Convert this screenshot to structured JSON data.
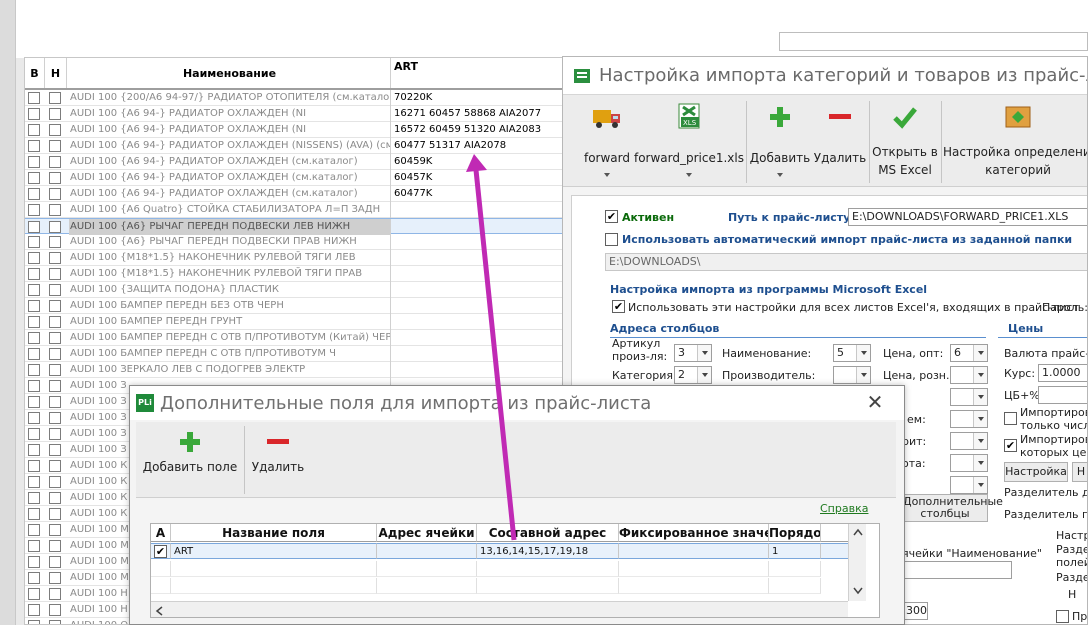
{
  "grid": {
    "headers": {
      "b": "В",
      "n": "Н",
      "name": "Наименование",
      "art": "ART"
    },
    "rows": [
      {
        "name": "AUDI 100 {200/A6 94-97/} РАДИАТОР ОТОПИТЕЛЯ (см.каталог)",
        "art": "70220K"
      },
      {
        "name": "AUDI 100 {A6 94-} РАДИАТОР ОХЛАЖДЕН (NI",
        "art": "16271 60457 58868 AIA2077"
      },
      {
        "name": "AUDI 100 {A6 94-} РАДИАТОР ОХЛАЖДЕН (NI",
        "art": "16572 60459 51320 AIA2083"
      },
      {
        "name": "AUDI 100 {A6 94-} РАДИАТОР ОХЛАЖДЕН (NISSENS) (AVA) (см.к",
        "art": "60477 51317 AIA2078"
      },
      {
        "name": "AUDI 100 {A6 94-} РАДИАТОР ОХЛАЖДЕН (см.каталог)",
        "art": "60459K"
      },
      {
        "name": "AUDI 100 {A6 94-} РАДИАТОР ОХЛАЖДЕН (см.каталог)",
        "art": "60457K"
      },
      {
        "name": "AUDI 100 {A6 94-} РАДИАТОР ОХЛАЖДЕН (см.каталог)",
        "art": "60477K"
      },
      {
        "name": "AUDI 100 {A6 Quatro} СТОЙКА СТАБИЛИЗАТОРА Л=П ЗАДН",
        "art": ""
      },
      {
        "name": "AUDI 100 {A6} РЫЧАГ ПЕРЕДН ПОДВЕСКИ ЛЕВ НИЖН",
        "art": ""
      },
      {
        "name": "AUDI 100 {A6} РЫЧАГ ПЕРЕДН ПОДВЕСКИ ПРАВ НИЖН",
        "art": ""
      },
      {
        "name": "AUDI 100 {M18*1.5} НАКОНЕЧНИК РУЛЕВОЙ ТЯГИ ЛЕВ",
        "art": ""
      },
      {
        "name": "AUDI 100 {M18*1.5} НАКОНЕЧНИК РУЛЕВОЙ ТЯГИ ПРАВ",
        "art": ""
      },
      {
        "name": "AUDI 100 {ЗАЩИТА ПОДОНА} ПЛАСТИК",
        "art": ""
      },
      {
        "name": "AUDI 100 БАМПЕР ПЕРЕДН БЕЗ ОТВ ЧЕРН",
        "art": ""
      },
      {
        "name": "AUDI 100 БАМПЕР ПЕРЕДН ГРУНТ",
        "art": ""
      },
      {
        "name": "AUDI 100 БАМПЕР ПЕРЕДН С ОТВ П/ПРОТИВОТУМ (Китай) ЧЕРН",
        "art": ""
      },
      {
        "name": "AUDI 100 БАМПЕР ПЕРЕДН С ОТВ П/ПРОТИВОТУМ Ч",
        "art": ""
      },
      {
        "name": "AUDI 100 ЗЕРКАЛО ЛЕВ С ПОДОГРЕВ ЭЛЕКТР",
        "art": ""
      },
      {
        "name": "AUDI 100 З",
        "art": ""
      },
      {
        "name": "AUDI 100 З",
        "art": ""
      },
      {
        "name": "AUDI 100 З",
        "art": ""
      },
      {
        "name": "AUDI 100 З",
        "art": ""
      },
      {
        "name": "AUDI 100 З",
        "art": ""
      },
      {
        "name": "AUDI 100 К",
        "art": ""
      },
      {
        "name": "AUDI 100 К",
        "art": ""
      },
      {
        "name": "AUDI 100 К",
        "art": ""
      },
      {
        "name": "AUDI 100 К",
        "art": ""
      },
      {
        "name": "AUDI 100 М",
        "art": ""
      },
      {
        "name": "AUDI 100 М",
        "art": ""
      },
      {
        "name": "AUDI 100 М",
        "art": ""
      },
      {
        "name": "AUDI 100 М",
        "art": ""
      },
      {
        "name": "AUDI 100 Н",
        "art": ""
      },
      {
        "name": "AUDI 100 Н",
        "art": ""
      },
      {
        "name": "AUDI 100 О",
        "art": ""
      }
    ]
  },
  "settings": {
    "title": "Настройка импорта категорий и товаров из прайс-листо",
    "ribbon": {
      "forward": "forward",
      "forward_price": "forward_price1.xls",
      "add": "Добавить",
      "delete": "Удалить",
      "open_excel_1": "Открыть в",
      "open_excel_2": "MS Excel",
      "cat_def_1": "Настройка определения",
      "cat_def_2": "категорий"
    },
    "active_label": "Активен",
    "path_label": "Путь к прайс-листу:",
    "path_value": "E:\\DOWNLOADS\\FORWARD_PRICE1.XLS",
    "auto_import_label": "Использовать автоматический импорт прайс-листа из заданной папки",
    "folder_value": "E:\\DOWNLOADS\\",
    "excel_section": "Настройка импорта из программы Microsoft Excel",
    "use_all_sheets": "Использовать эти настройки для всех листов Excel'я, входящих в прайс-лист",
    "password_label": "Пароль:",
    "columns_section": "Адреса столбцов",
    "prices_section": "Цены",
    "article_label_1": "Артикул",
    "article_label_2": "произ-ля:",
    "article_value": "3",
    "name_label": "Наименование:",
    "name_value": "5",
    "price_opt_label": "Цена, опт:",
    "price_opt_value": "6",
    "category_label": "Категория:",
    "category_value": "2",
    "manufacturer_label": "Производитель:",
    "price_retail_label": "Цена, розн.:",
    "currency_label": "Валюта прайс-ли",
    "rate_label": "Курс:",
    "rate_value": "1.0000",
    "cb_label": "ЦБ+%",
    "import_numbers_1": "Импортирова",
    "import_numbers_2": "только числа",
    "import_with_price_1": "Импортирова",
    "import_with_price_2": "которых цена",
    "settings_btn": "Настройка",
    "settings_btn2": "Н",
    "extra_fields_btn_1": "Дополнительные",
    "extra_fields_btn_2": "столбцы",
    "sep_dec_label": "Разделитель дес",
    "sep_grp_label": "Разделитель гру",
    "partial_label_1": "ем:",
    "partial_label_2": "рит:",
    "partial_label_3": "ота:",
    "partial_label_4": ":",
    "col_name_hint": "ячейки \"Наименование\"",
    "small_value": "300",
    "right_lbl_1": "Настро",
    "right_lbl_2": "Раздел",
    "right_lbl_3": "полей",
    "right_lbl_4": "Раздел",
    "right_lbl_5": "Н",
    "right_lbl_6": "Пра"
  },
  "dialog": {
    "title": "Дополнительные поля для импорта из прайс-листа",
    "logo": "PLi",
    "add_label": "Добавить поле",
    "delete_label": "Удалить",
    "help": "Справка",
    "columns": [
      "A",
      "Название поля",
      "Адрес ячейки",
      "Составной адрес",
      "Фиксированное значение",
      "Порядок"
    ],
    "rows": [
      {
        "name": "ART",
        "address": "",
        "composite": "13,16,14,15,17,19,18",
        "fixed": "",
        "order": "1"
      }
    ]
  },
  "colors": {
    "accent_green": "#3aa83a",
    "delete_red": "#d9262a",
    "arrow": "#c02ab4",
    "selection": "#e6f0fb"
  }
}
